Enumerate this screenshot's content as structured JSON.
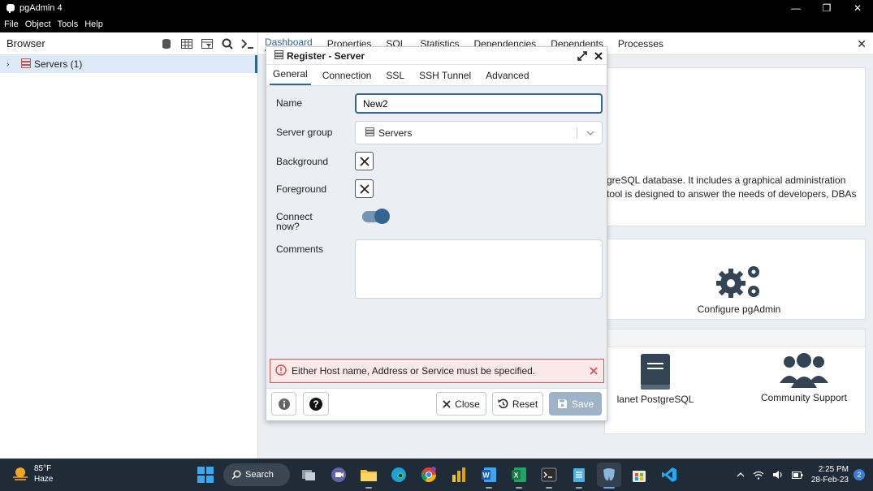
{
  "window": {
    "title": "pgAdmin 4"
  },
  "menu": [
    "File",
    "Object",
    "Tools",
    "Help"
  ],
  "browser": {
    "title": "Browser",
    "tree": {
      "servers_label": "Servers (1)"
    }
  },
  "main_tabs": [
    "Dashboard",
    "Properties",
    "SQL",
    "Statistics",
    "Dependencies",
    "Dependents",
    "Processes"
  ],
  "dashboard": {
    "welcome_line1": "greSQL database. It includes a graphical administration",
    "welcome_line2": "tool is designed to answer the needs of developers, DBAs",
    "configure_label": "Configure pgAdmin",
    "planet_label": "lanet PostgreSQL",
    "community_label": "Community Support"
  },
  "dialog": {
    "title": "Register - Server",
    "tabs": [
      "General",
      "Connection",
      "SSL",
      "SSH Tunnel",
      "Advanced"
    ],
    "fields": {
      "name_label": "Name",
      "name_value": "New2",
      "server_group_label": "Server group",
      "server_group_value": "Servers",
      "background_label": "Background",
      "foreground_label": "Foreground",
      "connect_now_label_1": "Connect",
      "connect_now_label_2": "now?",
      "connect_now": true,
      "comments_label": "Comments"
    },
    "error": "Either Host name, Address or Service must be specified.",
    "buttons": {
      "close": "Close",
      "reset": "Reset",
      "save": "Save"
    }
  },
  "taskbar": {
    "weather_temp": "85°F",
    "weather_desc": "Haze",
    "search_label": "Search",
    "time": "2:25 PM",
    "date": "28-Feb-23",
    "notifications": "2"
  },
  "colors": {
    "accent": "#326690",
    "error": "#d9534f",
    "taskbar": "#1f2b36"
  }
}
